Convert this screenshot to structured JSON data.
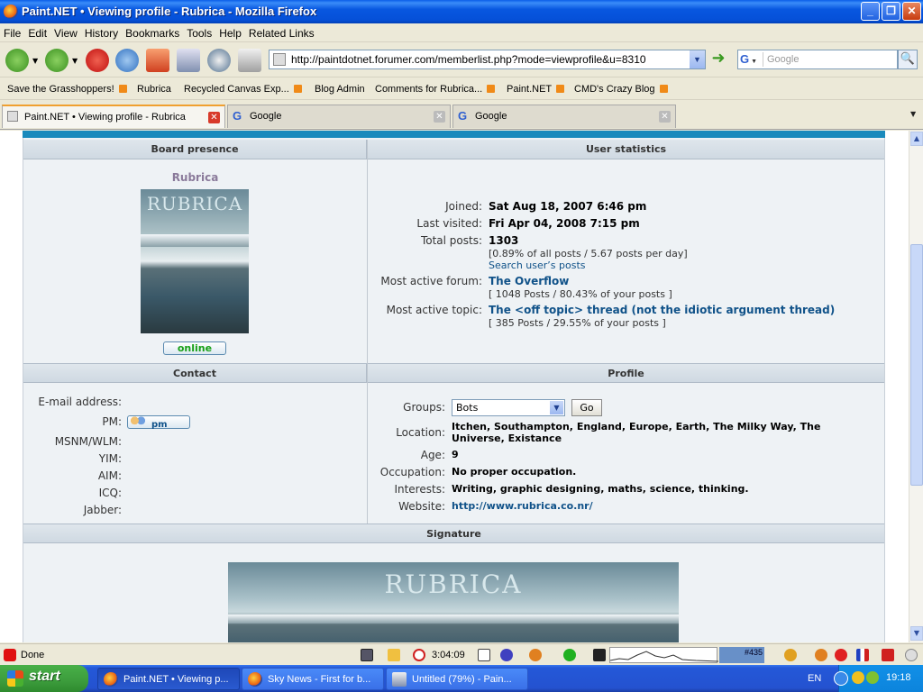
{
  "window": {
    "title": "Paint.NET • Viewing profile - Rubrica - Mozilla Firefox",
    "controls": {
      "minimize": "_",
      "maximize": "❐",
      "close": "✕"
    }
  },
  "menu": [
    "File",
    "Edit",
    "View",
    "History",
    "Bookmarks",
    "Tools",
    "Help",
    "Related Links"
  ],
  "toolbar": {
    "url": "http://paintdotnet.forumer.com/memberlist.php?mode=viewprofile&u=8310",
    "search_placeholder": "Google",
    "search_engine": "G"
  },
  "bookmarks": [
    {
      "label": "Save the Grasshoppers!",
      "rss": true
    },
    {
      "label": "Rubrica",
      "rss": false
    },
    {
      "label": "Recycled Canvas Exp...",
      "rss": true
    },
    {
      "label": "Blog Admin",
      "rss": false
    },
    {
      "label": "Comments for Rubrica...",
      "rss": true
    },
    {
      "label": "Paint.NET",
      "rss": true
    },
    {
      "label": "CMD's Crazy Blog",
      "rss": true
    }
  ],
  "tabs": [
    {
      "label": "Paint.NET • Viewing profile - Rubrica",
      "active": true
    },
    {
      "label": "Google",
      "active": false
    },
    {
      "label": "Google",
      "active": false
    }
  ],
  "profile": {
    "board_presence_header": "Board presence",
    "user_statistics_header": "User statistics",
    "username": "Rubrica",
    "avatar_text": "RUBRICA",
    "online_label": "online",
    "stats": {
      "joined_label": "Joined:",
      "joined_value": "Sat Aug 18, 2007 6:46 pm",
      "last_visited_label": "Last visited:",
      "last_visited_value": "Fri Apr 04, 2008 7:15 pm",
      "total_posts_label": "Total posts:",
      "total_posts_value": "1303",
      "total_posts_detail": "[0.89% of all posts / 5.67 posts per day]",
      "search_posts_link": "Search user’s posts",
      "most_active_forum_label": "Most active forum:",
      "most_active_forum_value": "The Overflow",
      "most_active_forum_detail": "[ 1048 Posts / 80.43% of your posts ]",
      "most_active_topic_label": "Most active topic:",
      "most_active_topic_value": "The <off topic> thread (not the idiotic argument thread)",
      "most_active_topic_detail": "[ 385 Posts / 29.55% of your posts ]"
    },
    "contact_header": "Contact",
    "profile_header": "Profile",
    "contact": {
      "email_label": "E-mail address:",
      "pm_label": "PM:",
      "pm_button": "pm",
      "msnm_label": "MSNM/WLM:",
      "yim_label": "YIM:",
      "aim_label": "AIM:",
      "icq_label": "ICQ:",
      "jabber_label": "Jabber:"
    },
    "details": {
      "groups_label": "Groups:",
      "groups_selected": "Bots",
      "go_button": "Go",
      "location_label": "Location:",
      "location_line1": "Itchen, Southampton, England, Europe, Earth, The Milky Way, The",
      "location_line2": "Universe, Existance",
      "age_label": "Age:",
      "age_value": "9",
      "occupation_label": "Occupation:",
      "occupation_value": "No proper occupation.",
      "interests_label": "Interests:",
      "interests_value": "Writing, graphic designing, maths, science, thinking.",
      "website_label": "Website:",
      "website_value": "http://www.rubrica.co.nr/"
    },
    "signature_header": "Signature",
    "signature_text": "RUBRICA"
  },
  "statusbar": {
    "status": "Done",
    "clock": "3:04:09",
    "counter": "#435"
  },
  "taskbar": {
    "start_label": "start",
    "tasks": [
      {
        "label": "Paint.NET • Viewing p...",
        "active": true
      },
      {
        "label": "Sky News - First for b...",
        "active": false
      },
      {
        "label": "Untitled (79%) - Pain...",
        "active": false
      }
    ],
    "language": "EN",
    "time": "19:18"
  }
}
